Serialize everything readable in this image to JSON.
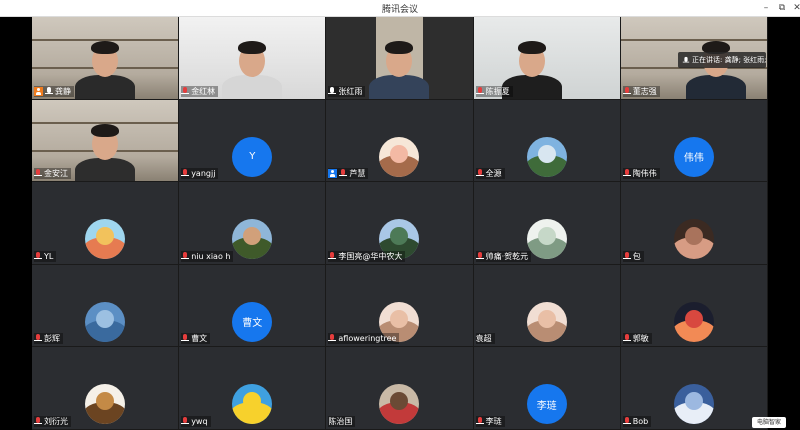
{
  "window": {
    "title": "腾讯会议",
    "buttons": {
      "minimize": "–",
      "maximize": "⧉",
      "close": "✕"
    }
  },
  "speaking_indicator": "正在讲话: 龚静; 张红雨;",
  "watermark": "电脑智家",
  "participants": [
    {
      "name": "龚静",
      "mic": "on",
      "badge": "orange",
      "view": "video",
      "active": true
    },
    {
      "name": "金红林",
      "mic": "off",
      "view": "video"
    },
    {
      "name": "张红雨",
      "mic": "on",
      "view": "video"
    },
    {
      "name": "陈振夏",
      "mic": "off",
      "view": "video"
    },
    {
      "name": "董志强",
      "mic": "off",
      "view": "video"
    },
    {
      "name": "金安江",
      "mic": "off",
      "view": "video"
    },
    {
      "name": "yangjj",
      "mic": "off",
      "view": "avatar",
      "avatar_text": "Y"
    },
    {
      "name": "芦慧",
      "mic": "off",
      "badge": "blue",
      "view": "avatar",
      "avatar_image": "cartoon-pig-icon"
    },
    {
      "name": "全源",
      "mic": "off",
      "view": "avatar",
      "avatar_image": "landscape-photo-icon"
    },
    {
      "name": "陶伟伟",
      "mic": "off",
      "view": "avatar",
      "avatar_text": "伟伟"
    },
    {
      "name": "YL",
      "mic": "off",
      "view": "avatar",
      "avatar_image": "cartoon-kids-icon"
    },
    {
      "name": "niu xiao h",
      "mic": "off",
      "view": "avatar",
      "avatar_image": "group-photo-icon"
    },
    {
      "name": "李国亮@华中农大",
      "mic": "off",
      "view": "avatar",
      "avatar_image": "lake-photo-icon"
    },
    {
      "name": "帅痛·贺乾元",
      "mic": "off",
      "view": "avatar",
      "avatar_image": "anime-character-icon"
    },
    {
      "name": "包",
      "mic": "off",
      "view": "avatar",
      "avatar_image": "portrait-photo-icon"
    },
    {
      "name": "彭辉",
      "mic": "off",
      "view": "avatar",
      "avatar_image": "blue-pattern-icon"
    },
    {
      "name": "曹文",
      "mic": "off",
      "view": "avatar",
      "avatar_text": "曹文"
    },
    {
      "name": "afloweringtree",
      "mic": "off",
      "view": "avatar",
      "avatar_image": "baby-photo-icon"
    },
    {
      "name": "袁超",
      "mic": "none",
      "view": "avatar",
      "avatar_image": "baby-photo-icon"
    },
    {
      "name": "郭敏",
      "mic": "off",
      "view": "avatar",
      "avatar_image": "sunset-photo-icon"
    },
    {
      "name": "刘衍光",
      "mic": "off",
      "view": "avatar",
      "avatar_image": "cartoon-squirrel-icon"
    },
    {
      "name": "ywq",
      "mic": "off",
      "view": "avatar",
      "avatar_image": "yellow-cartoon-icon"
    },
    {
      "name": "陈治国",
      "mic": "none",
      "view": "avatar",
      "avatar_image": "child-photo-icon"
    },
    {
      "name": "李琏",
      "mic": "off",
      "view": "avatar",
      "avatar_text": "李琏"
    },
    {
      "name": "Bob",
      "mic": "off",
      "view": "avatar",
      "avatar_image": "sky-photo-icon"
    }
  ],
  "colors": {
    "tile_bg": "#2b2d31",
    "avatar_blue": "#1677ee",
    "active_border": "#3fb55a",
    "mic_off": "#e63d3d"
  }
}
